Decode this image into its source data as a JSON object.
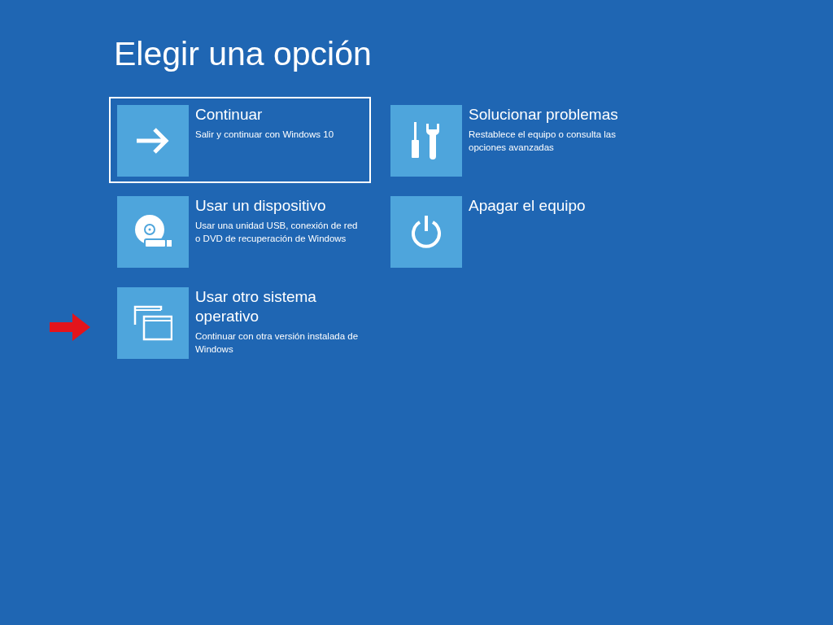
{
  "title": "Elegir una opción",
  "options": [
    {
      "kind": "arrow",
      "title": "Continuar",
      "description": "Salir y continuar con Windows 10",
      "selected": true
    },
    {
      "kind": "tools",
      "title": "Solucionar problemas",
      "description": "Restablece el equipo o consulta las opciones avanzadas",
      "selected": false
    },
    {
      "kind": "disc",
      "title": "Usar un dispositivo",
      "description": "Usar una unidad USB, conexión de red o DVD de recuperación de Windows",
      "selected": false
    },
    {
      "kind": "power",
      "title": "Apagar el equipo",
      "selected": false
    },
    {
      "kind": "windows",
      "title": "Usar otro sistema operativo",
      "description": "Continuar con otra versión instalada de Windows",
      "selected": false
    }
  ]
}
